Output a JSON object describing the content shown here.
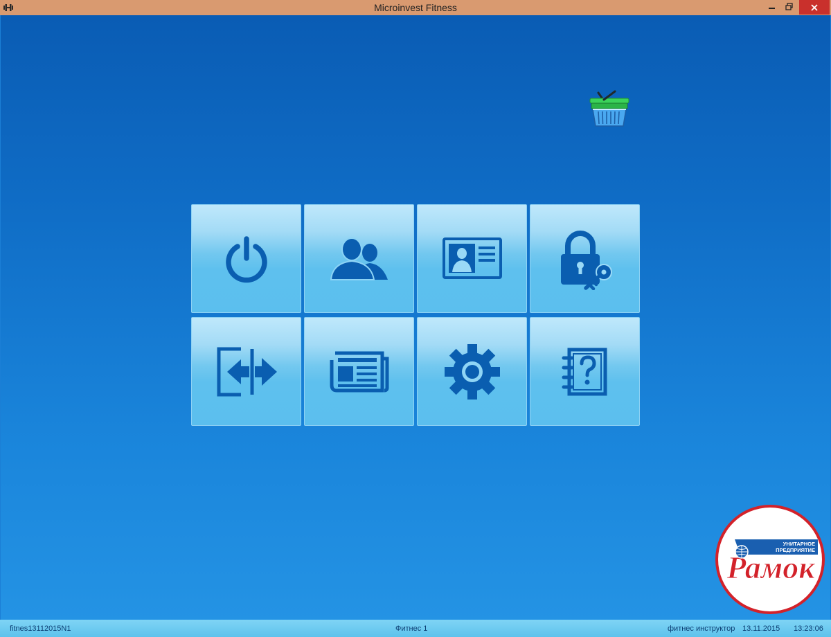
{
  "window": {
    "title": "Microinvest Fitness"
  },
  "icons": {
    "app": "dumbbell-icon",
    "basket": "shopping-basket-icon",
    "tiles": [
      "power-icon",
      "users-icon",
      "id-card-icon",
      "lock-key-icon",
      "exchange-arrows-icon",
      "news-icon",
      "gear-icon",
      "help-notebook-icon"
    ]
  },
  "logo": {
    "text": "Рамок",
    "subtitle_line1": "УНИТАРНОЕ",
    "subtitle_line2": "ПРЕДПРИЯТИЕ"
  },
  "status": {
    "database": "fitnes13112015N1",
    "object": "Фитнес 1",
    "user": "фитнес инструктор",
    "date": "13.11.2015",
    "time": "13:23:06"
  },
  "colors": {
    "title_bar": "#d99a70",
    "close_button": "#c9302c",
    "tile_icon": "#0a5eb0",
    "desktop_top": "#0a5cb4",
    "desktop_bottom": "#2493e4",
    "logo_red": "#d3222a",
    "logo_blue": "#1a5fb0"
  }
}
